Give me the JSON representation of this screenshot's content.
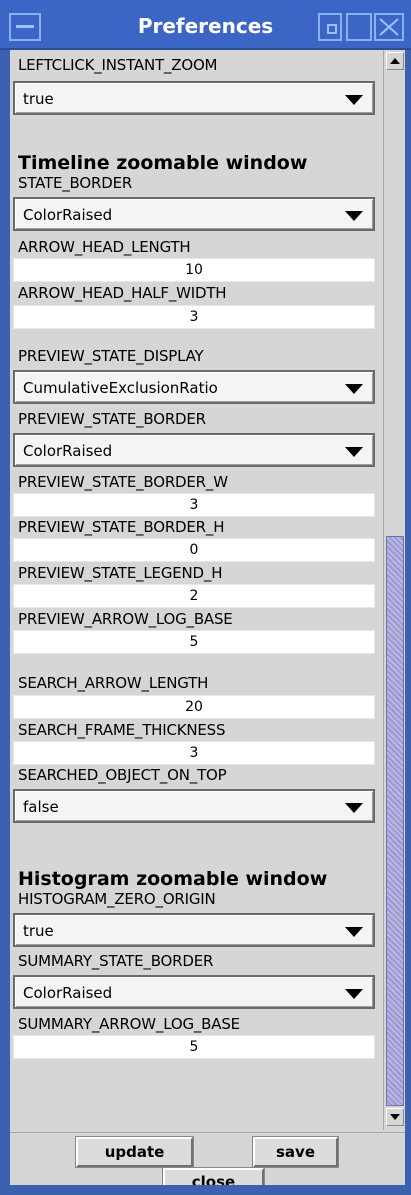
{
  "window": {
    "title": "Preferences"
  },
  "rows": [
    {
      "label": "LEFTCLICK_INSTANT_ZOOM",
      "kind": "combo",
      "value": "true"
    },
    {
      "section": "Timeline zoomable window"
    },
    {
      "label": "STATE_BORDER",
      "kind": "combo",
      "value": "ColorRaised"
    },
    {
      "label": "ARROW_HEAD_LENGTH",
      "kind": "field",
      "value": "10"
    },
    {
      "label": "ARROW_HEAD_HALF_WIDTH",
      "kind": "field",
      "value": "3"
    },
    {
      "label": "PREVIEW_STATE_DISPLAY",
      "kind": "combo",
      "value": "CumulativeExclusionRatio"
    },
    {
      "label": "PREVIEW_STATE_BORDER",
      "kind": "combo",
      "value": "ColorRaised"
    },
    {
      "label": "PREVIEW_STATE_BORDER_W",
      "kind": "field",
      "value": "3"
    },
    {
      "label": "PREVIEW_STATE_BORDER_H",
      "kind": "field",
      "value": "0"
    },
    {
      "label": "PREVIEW_STATE_LEGEND_H",
      "kind": "field",
      "value": "2"
    },
    {
      "label": "PREVIEW_ARROW_LOG_BASE",
      "kind": "field",
      "value": "5"
    },
    {
      "label": "SEARCH_ARROW_LENGTH",
      "kind": "field",
      "value": "20"
    },
    {
      "label": "SEARCH_FRAME_THICKNESS",
      "kind": "field",
      "value": "3"
    },
    {
      "label": "SEARCHED_OBJECT_ON_TOP",
      "kind": "combo",
      "value": "false"
    },
    {
      "section": "Histogram zoomable window"
    },
    {
      "label": "HISTOGRAM_ZERO_ORIGIN",
      "kind": "combo",
      "value": "true"
    },
    {
      "label": "SUMMARY_STATE_BORDER",
      "kind": "combo",
      "value": "ColorRaised"
    },
    {
      "label": "SUMMARY_ARROW_LOG_BASE",
      "kind": "field",
      "value": "5"
    }
  ],
  "buttons": {
    "update": "update",
    "save": "save",
    "close": "close"
  },
  "icons": {
    "window_menu": "window-menu-icon",
    "minimize": "minimize-icon",
    "maximize": "maximize-icon",
    "close": "close-icon",
    "dropdown": "chevron-down-icon",
    "scroll_up": "arrow-up-icon",
    "scroll_down": "arrow-down-icon"
  },
  "colors": {
    "titlebar": "#3c66c6",
    "panel": "#d6d6d6",
    "scroll_thumb": "#a8a8d8"
  }
}
